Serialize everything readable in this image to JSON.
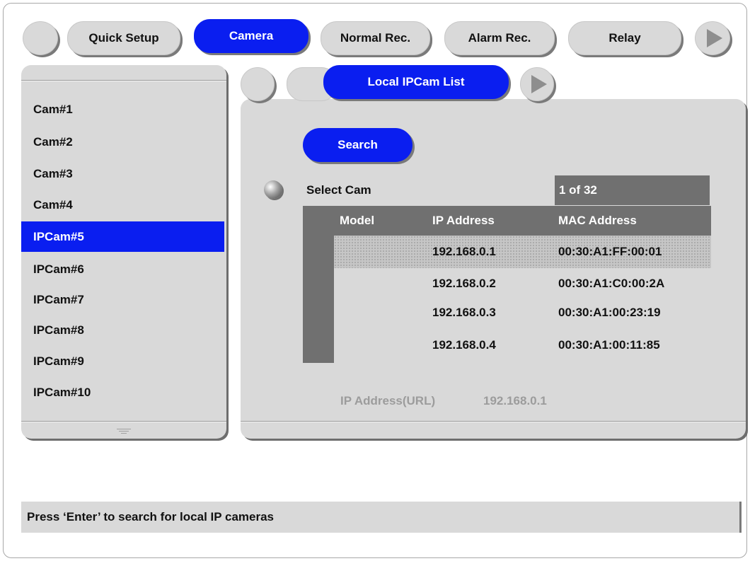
{
  "tabs": [
    {
      "label": "Quick Setup",
      "active": false
    },
    {
      "label": "Camera",
      "active": true
    },
    {
      "label": "Normal Rec.",
      "active": false
    },
    {
      "label": "Alarm Rec.",
      "active": false
    },
    {
      "label": "Relay",
      "active": false
    }
  ],
  "sidebar": {
    "items": [
      "Cam#1",
      "Cam#2",
      "Cam#3",
      "Cam#4",
      "IPCam#5",
      "IPCam#6",
      "IPCam#7",
      "IPCam#8",
      "IPCam#9",
      "IPCam#10"
    ],
    "selected": "IPCam#5"
  },
  "subtab": {
    "label": "Local IPCam List"
  },
  "search": {
    "label": "Search"
  },
  "select_cam": {
    "label": "Select Cam",
    "counter": "1 of 32"
  },
  "table": {
    "headers": [
      "Model",
      "IP Address",
      "MAC Address"
    ],
    "rows": [
      {
        "model": "",
        "ip": "192.168.0.1",
        "mac": "00:30:A1:FF:00:01",
        "highlighted": true
      },
      {
        "model": "",
        "ip": "192.168.0.2",
        "mac": "00:30:A1:C0:00:2A",
        "highlighted": false
      },
      {
        "model": "",
        "ip": "192.168.0.3",
        "mac": "00:30:A1:00:23:19",
        "highlighted": false
      },
      {
        "model": "",
        "ip": "192.168.0.4",
        "mac": "00:30:A1:00:11:85",
        "highlighted": false
      }
    ]
  },
  "url": {
    "label": "IP Address(URL)",
    "value": "192.168.0.1"
  },
  "status": {
    "text": "Press ‘Enter’ to search for local IP cameras"
  },
  "icons": {
    "next_tab": "play-arrow-icon",
    "next_subtab": "play-arrow-icon",
    "radio": "radio-button-icon",
    "grip": "scroll-grip-icon"
  },
  "colors": {
    "accent": "#0a1ef0",
    "panel": "#d9d9d9",
    "header": "#707070"
  }
}
